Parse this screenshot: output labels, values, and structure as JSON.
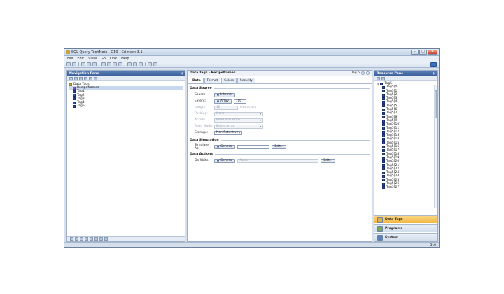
{
  "window": {
    "title": "SQL Query TechNote - G10 - Crimson 3.1",
    "controls": {
      "minimize": "–",
      "maximize": "□",
      "close": "✕"
    }
  },
  "menu": [
    "File",
    "Edit",
    "View",
    "Go",
    "Link",
    "Help"
  ],
  "navigation": {
    "header": "Navigation Pane",
    "close": "✕",
    "tree": {
      "root": "Data Tags",
      "recipe": "RecipeNames",
      "tags": [
        "Tag1",
        "Tag2",
        "Tag3",
        "Tag4",
        "Tag5"
      ]
    }
  },
  "editor": {
    "header": "Data Tags - RecipeNames",
    "tag_indicator": "Tag 5",
    "tabs": [
      "Data",
      "Format",
      "Colors",
      "Security"
    ],
    "data_source": {
      "title": "Data Source",
      "source_label": "Source:",
      "source_value": "Internal",
      "extent_label": "Extent:",
      "extent_mode": "Array",
      "extent_value": "100",
      "length_label": "Length:",
      "length_value": "16",
      "length_unit": "characters",
      "packing_label": "Packing:",
      "packing_value": "None",
      "access_label": "Access:",
      "access_value": "Read and Write",
      "readmode_label": "Read Mode:",
      "readmode_value": "Entire Array",
      "storage_label": "Storage:",
      "storage_value": "Non-Retentive"
    },
    "data_simulation": {
      "title": "Data Simulation",
      "simulate_label": "Simulate As:",
      "simulate_mode": "General",
      "edit": "Edit..."
    },
    "data_actions": {
      "title": "Data Actions",
      "onwrite_label": "On Write:",
      "onwrite_mode": "General",
      "onwrite_value": "None",
      "edit": "Edit..."
    }
  },
  "resource": {
    "header": "Resource Pane",
    "close": "✕",
    "root": "Tag5",
    "items": [
      "Tag5[0]",
      "Tag5[1]",
      "Tag5[2]",
      "Tag5[3]",
      "Tag5[4]",
      "Tag5[5]",
      "Tag5[6]",
      "Tag5[7]",
      "Tag5[8]",
      "Tag5[9]",
      "Tag5[10]",
      "Tag5[11]",
      "Tag5[12]",
      "Tag5[13]",
      "Tag5[14]",
      "Tag5[15]",
      "Tag5[16]",
      "Tag5[17]",
      "Tag5[18]",
      "Tag5[19]",
      "Tag5[20]",
      "Tag5[21]",
      "Tag5[22]",
      "Tag5[23]",
      "Tag5[24]",
      "Tag5[25]",
      "Tag5[26]",
      "Tag5[27]"
    ],
    "buttons": [
      "Data Tags",
      "Programs",
      "System"
    ]
  },
  "status": {
    "right": "G10"
  },
  "colors": {
    "accent": "#3a5f98",
    "active_button": "#f1b43a"
  }
}
